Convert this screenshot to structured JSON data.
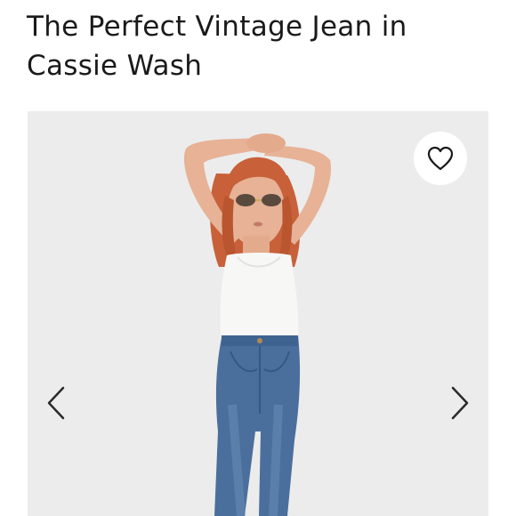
{
  "product": {
    "title": "The Perfect Vintage Jean in Cassie Wash"
  },
  "gallery": {
    "favorite_icon": "heart-outline-icon",
    "prev_icon": "chevron-left-icon",
    "next_icon": "chevron-right-icon",
    "photo_description_colors": {
      "background": "#ececec",
      "top": "#f7f7f5",
      "denim": "#4a6f9c",
      "hair": "#c8603a",
      "skin": "#e7b296"
    }
  }
}
